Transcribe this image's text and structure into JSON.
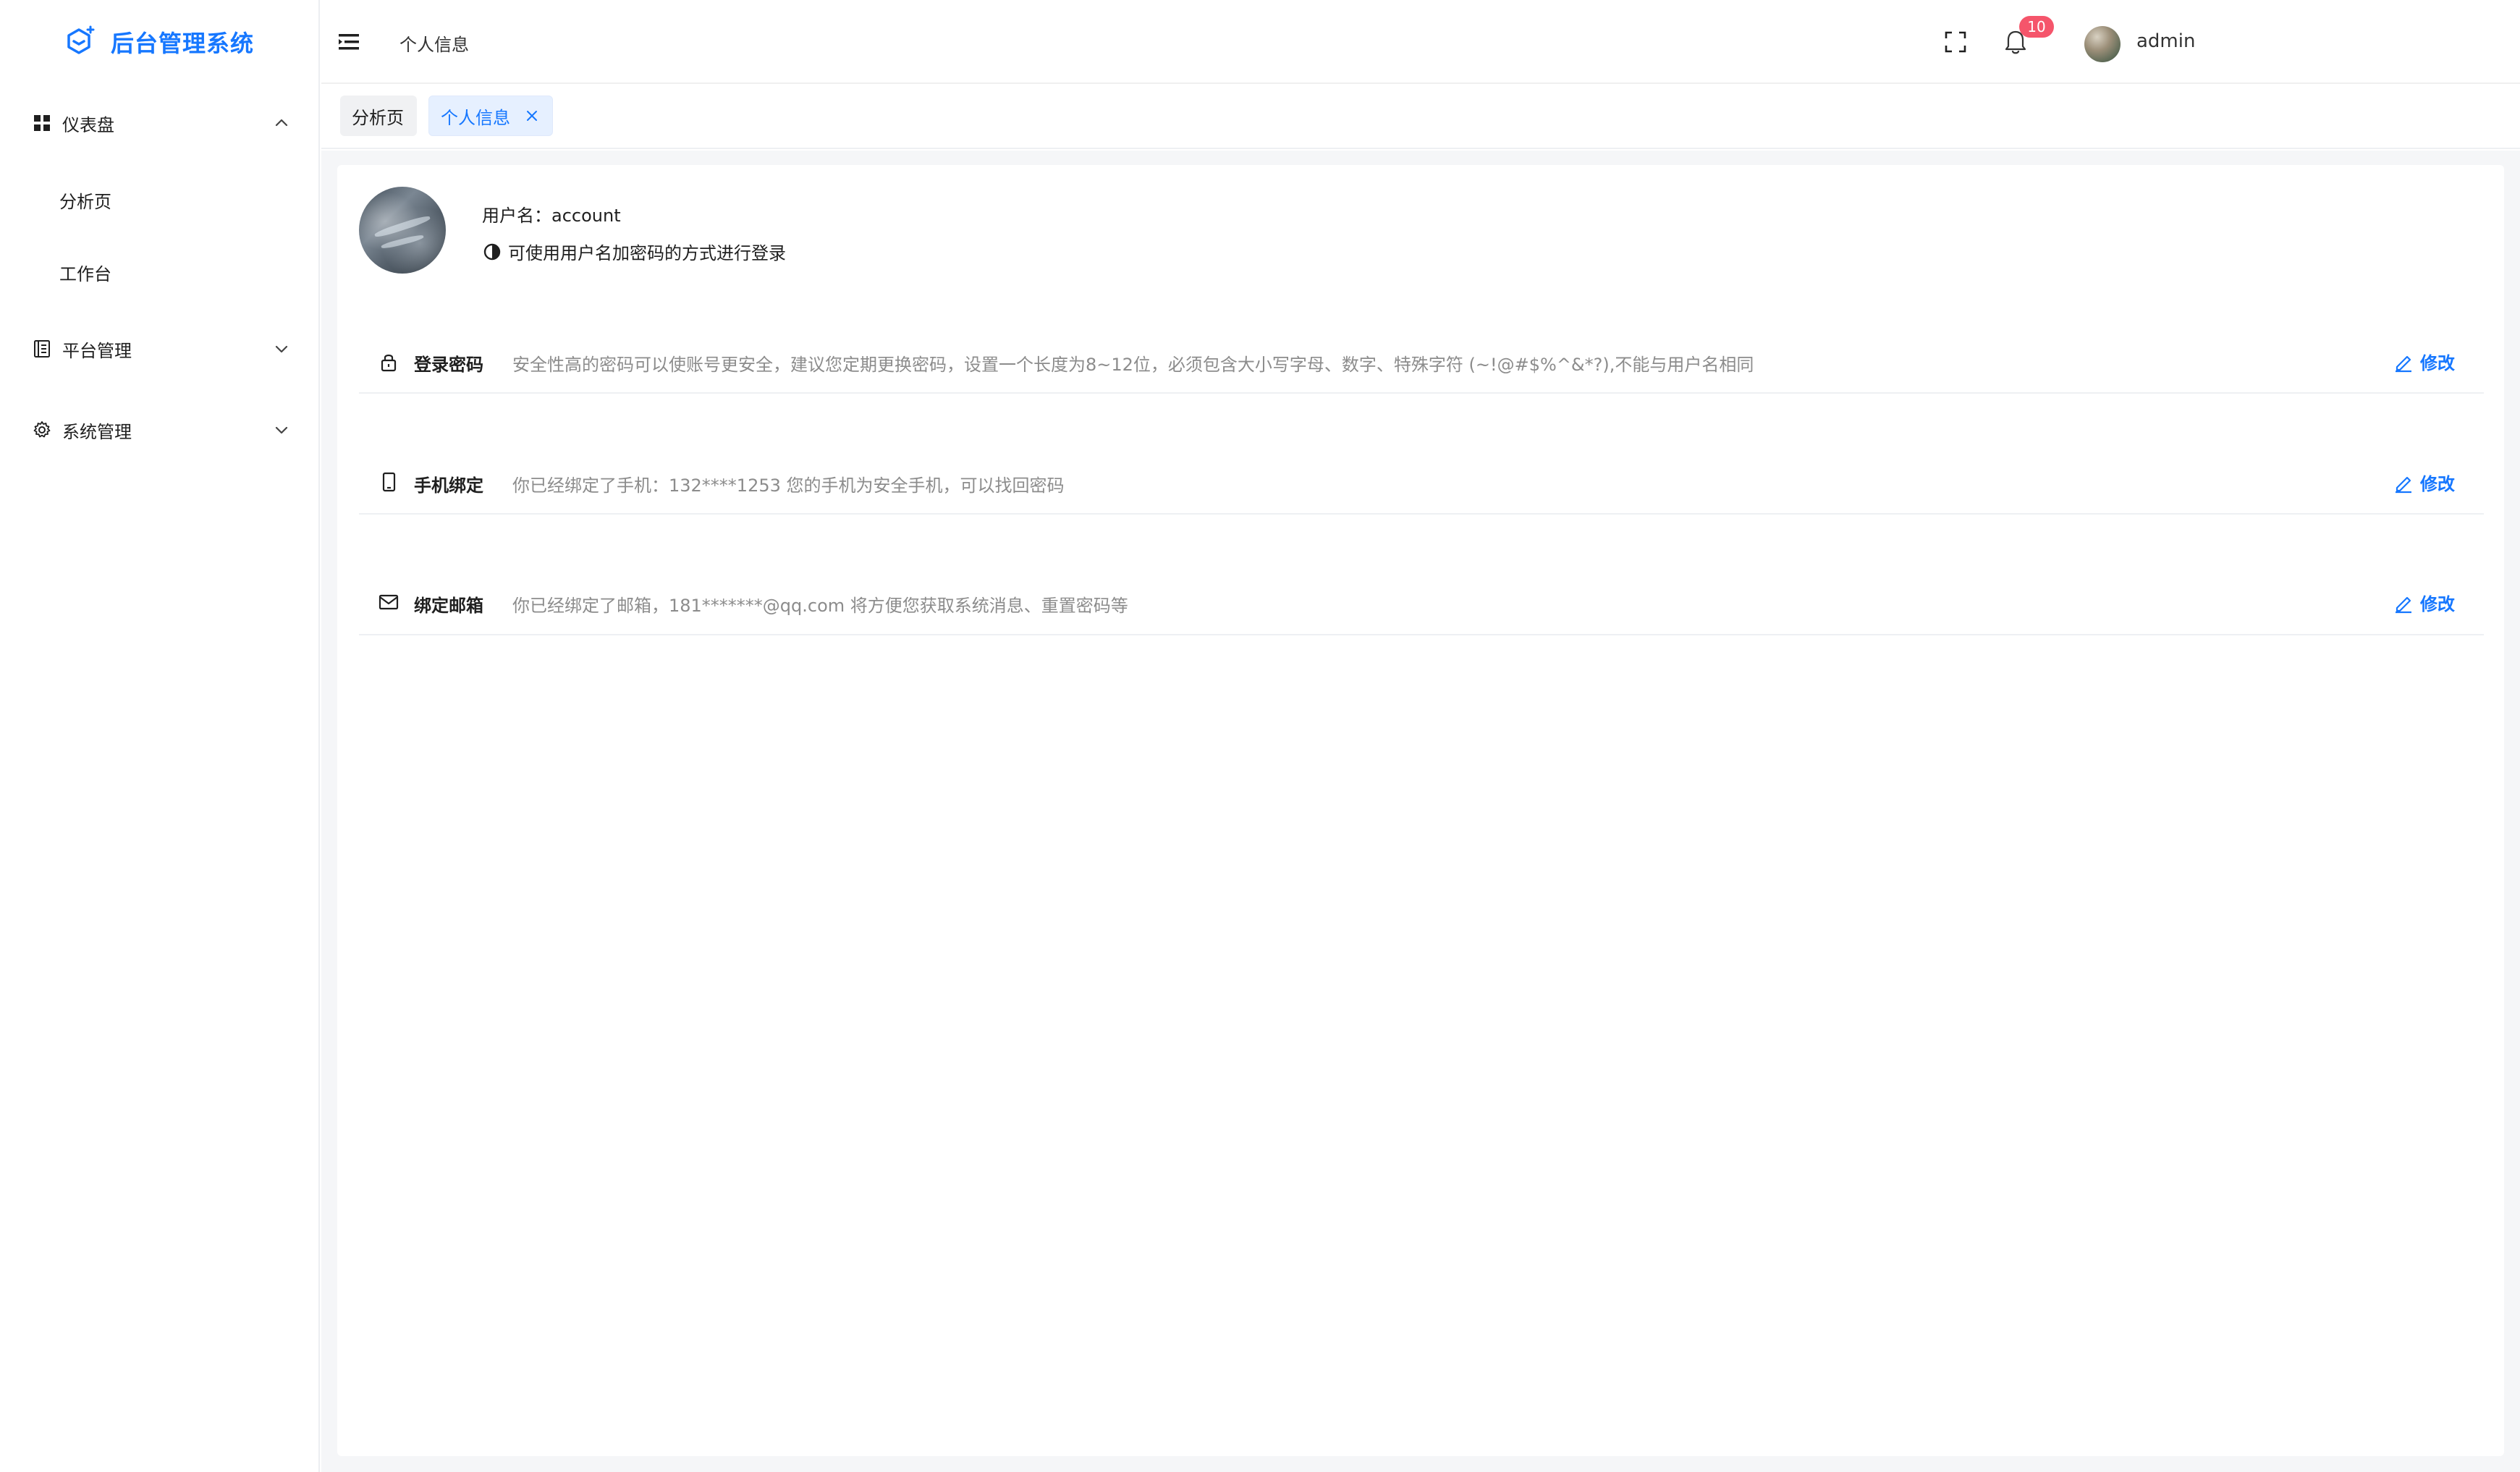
{
  "app": {
    "title": "后台管理系统",
    "brand_color": "#1677ff"
  },
  "sidebar": {
    "groups": [
      {
        "label": "仪表盘",
        "icon": "dashboard-grid-icon",
        "expanded": true,
        "items": [
          {
            "label": "分析页"
          },
          {
            "label": "工作台"
          }
        ]
      },
      {
        "label": "平台管理",
        "icon": "document-icon",
        "expanded": false
      },
      {
        "label": "系统管理",
        "icon": "gear-icon",
        "expanded": false
      }
    ]
  },
  "header": {
    "breadcrumb": "个人信息",
    "notification_count": "10",
    "username": "admin"
  },
  "tabs": [
    {
      "label": "分析页",
      "active": false
    },
    {
      "label": "个人信息",
      "active": true,
      "closable": true
    }
  ],
  "profile": {
    "username_line": "用户名：account",
    "login_hint": "可使用用户名加密码的方式进行登录"
  },
  "security": [
    {
      "icon": "lock-icon",
      "title": "登录密码",
      "description": "安全性高的密码可以使账号更安全，建议您定期更换密码，设置一个长度为8~12位，必须包含大小写字母、数字、特殊字符 (~!@#$%^&*?),不能与用户名相同",
      "action": "修改"
    },
    {
      "icon": "mobile-phone-icon",
      "title": "手机绑定",
      "description": "你已经绑定了手机：132****1253   您的手机为安全手机，可以找回密码",
      "action": "修改"
    },
    {
      "icon": "mail-icon",
      "title": "绑定邮箱",
      "description": "你已经绑定了邮箱，181*******@qq.com   将方便您获取系统消息、重置密码等",
      "action": "修改"
    }
  ]
}
